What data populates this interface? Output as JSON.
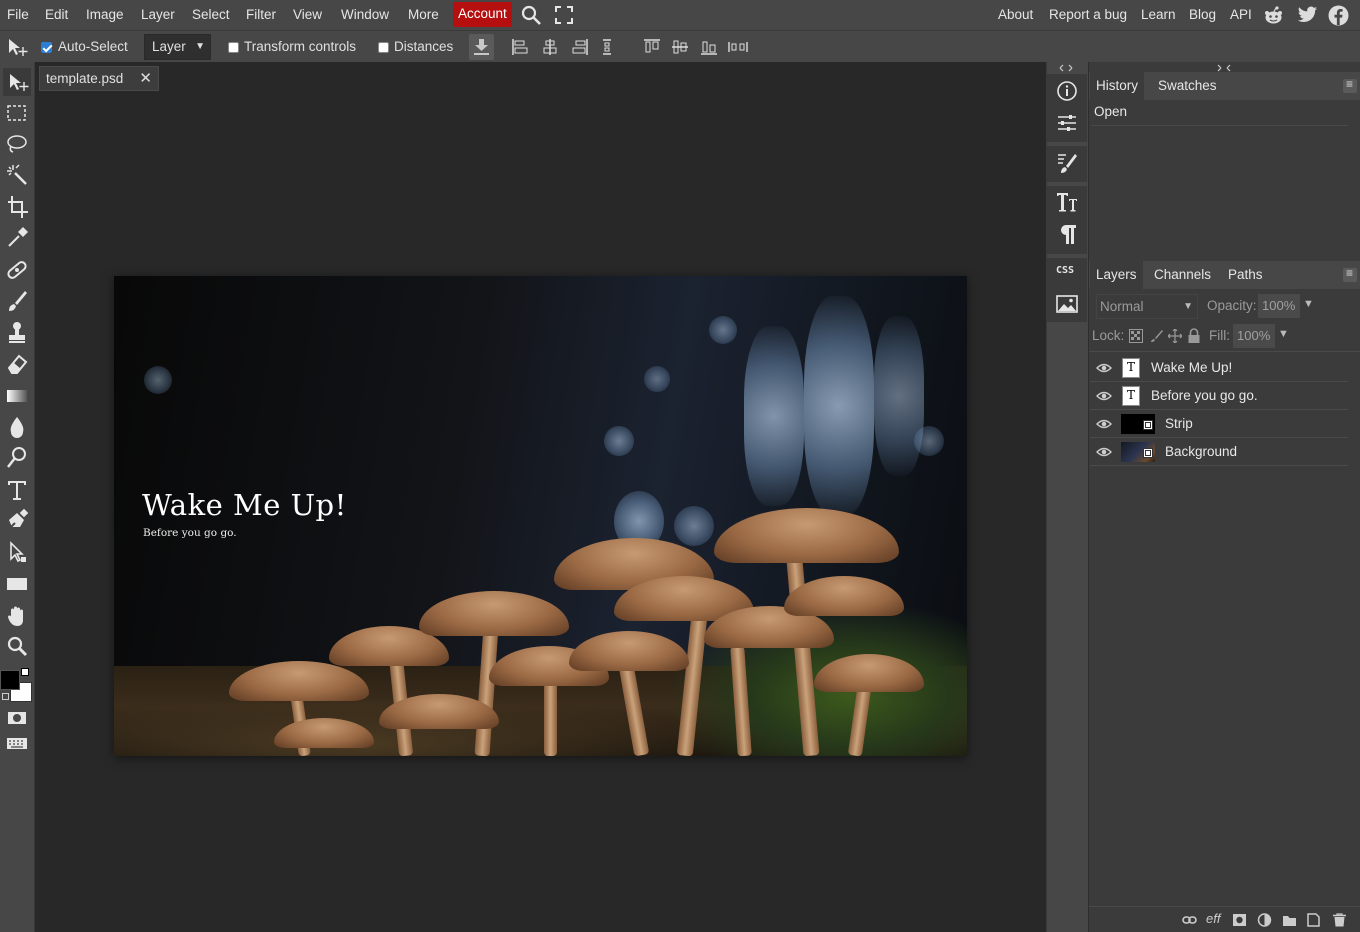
{
  "menubar": {
    "items": [
      "File",
      "Edit",
      "Image",
      "Layer",
      "Select",
      "Filter",
      "View",
      "Window",
      "More"
    ],
    "account": "Account",
    "right_links": [
      "About",
      "Report a bug",
      "Learn",
      "Blog",
      "API"
    ],
    "icons": [
      "search-icon",
      "fullscreen-icon",
      "reddit-icon",
      "twitter-icon",
      "facebook-icon"
    ]
  },
  "options": {
    "auto_select_label": "Auto-Select",
    "auto_select_checked": true,
    "target_value": "Layer",
    "transform_controls_label": "Transform controls",
    "distances_label": "Distances"
  },
  "document": {
    "tab_name": "template.psd",
    "close_glyph": "✕",
    "title_text": "Wake Me Up!",
    "subtitle_text": "Before you go go."
  },
  "history_panel": {
    "tabs": [
      "History",
      "Swatches"
    ],
    "items": [
      "Open"
    ]
  },
  "layers_panel": {
    "tabs": [
      "Layers",
      "Channels",
      "Paths"
    ],
    "blend_mode": "Normal",
    "opacity_label": "Opacity:",
    "opacity_value": "100%",
    "lock_label": "Lock:",
    "fill_label": "Fill:",
    "fill_value": "100%",
    "layers": [
      {
        "name": "Wake Me Up!",
        "kind": "text"
      },
      {
        "name": "Before you go go.",
        "kind": "text"
      },
      {
        "name": "Strip",
        "kind": "smart"
      },
      {
        "name": "Background",
        "kind": "smart-image"
      }
    ],
    "footer_label": "eff"
  },
  "colors": {
    "accent_account": "#b50f0f",
    "checkbox_blue": "#2d7fd6",
    "ui_dark": "#474747",
    "workspace": "#282828"
  }
}
